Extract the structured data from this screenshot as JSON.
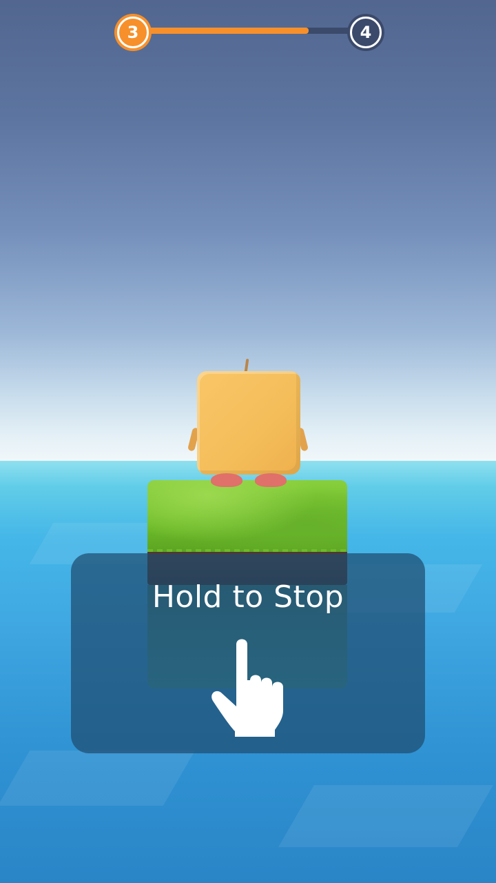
{
  "progress": {
    "current_level": "3",
    "next_level": "4",
    "fill_fraction": 0.78,
    "accent_color": "#f7902a",
    "track_color": "#3b4a6b"
  },
  "hint": {
    "text": "Hold to Stop",
    "icon": "pointing-hand-icon"
  }
}
